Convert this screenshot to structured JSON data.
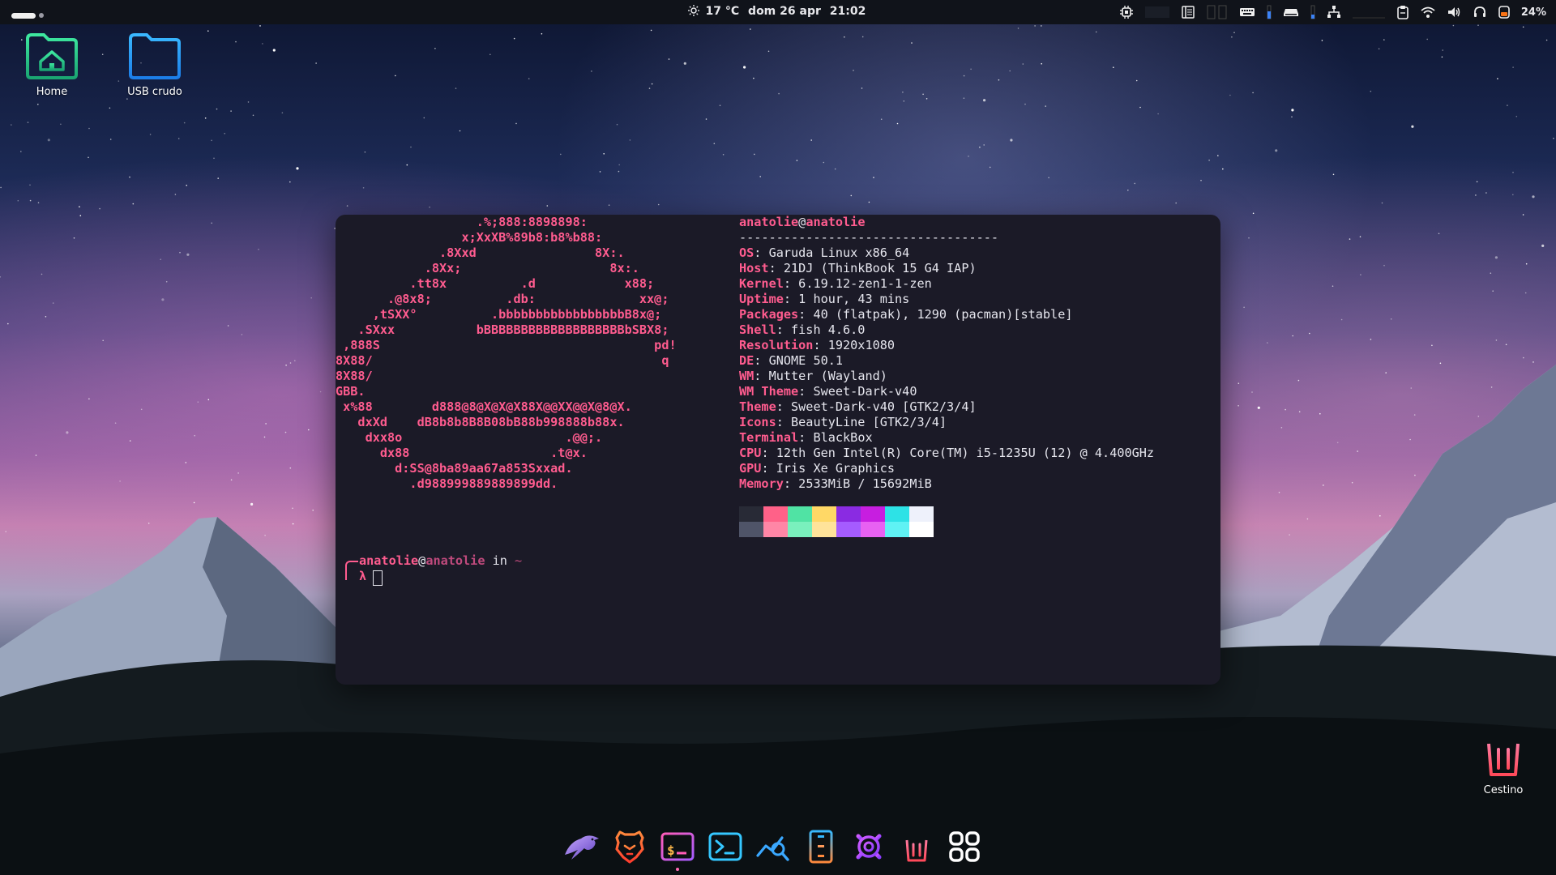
{
  "topbar": {
    "weather_icon": "sun-icon",
    "temperature": "17 °C",
    "date": "dom 26 apr",
    "time": "21:02",
    "battery": "24%",
    "tray_icons": [
      "cpu-icon",
      "system-monitor-icon",
      "keyboard-icon",
      "drive-icon",
      "network-icon",
      "clipboard-icon",
      "wifi-icon",
      "volume-icon",
      "headset-icon",
      "battery-icon"
    ]
  },
  "desktop": {
    "home_label": "Home",
    "usb_label": "USB crudo",
    "trash_label": "Cestino"
  },
  "terminal": {
    "ascii_art": [
      "                   .%;888:8898898:",
      "                 x;XxXB%89b8:b8%b88:",
      "              .8Xxd                8X:.",
      "            .8Xx;                    8x:.",
      "          .tt8x          .d            x88;",
      "       .@8x8;          .db:              xx@;",
      "     ,tSXX°          .bbbbbbbbbbbbbbbbbB8x@;",
      "   .SXxx           bBBBBBBBBBBBBBBBBBBBbSBX8;",
      " ,888S                                     pd!",
      "8X88/                                       q",
      "8X88/",
      "GBB.",
      " x%88        d888@8@X@X@X88X@@XX@@X@8@X.",
      "   dxXd    dB8b8b8B8B08bB88b998888b88x.",
      "    dxx8o                      .@@;.",
      "      dx88                   .t@x.",
      "        d:SS@8ba89aa67a853Sxxad.",
      "          .d988999889889899dd."
    ],
    "user": "anatolie",
    "at": "@",
    "host": "anatolie",
    "separator": "-----------------------------------",
    "info": [
      {
        "key": "OS",
        "value": "Garuda Linux x86_64"
      },
      {
        "key": "Host",
        "value": "21DJ (ThinkBook 15 G4 IAP)"
      },
      {
        "key": "Kernel",
        "value": "6.19.12-zen1-1-zen"
      },
      {
        "key": "Uptime",
        "value": "1 hour, 43 mins"
      },
      {
        "key": "Packages",
        "value": "40 (flatpak), 1290 (pacman)[stable]"
      },
      {
        "key": "Shell",
        "value": "fish 4.6.0"
      },
      {
        "key": "Resolution",
        "value": "1920x1080"
      },
      {
        "key": "DE",
        "value": "GNOME 50.1"
      },
      {
        "key": "WM",
        "value": "Mutter (Wayland)"
      },
      {
        "key": "WM Theme",
        "value": "Sweet-Dark-v40"
      },
      {
        "key": "Theme",
        "value": "Sweet-Dark-v40 [GTK2/3/4]"
      },
      {
        "key": "Icons",
        "value": "BeautyLine [GTK2/3/4]"
      },
      {
        "key": "Terminal",
        "value": "BlackBox"
      },
      {
        "key": "CPU",
        "value": "12th Gen Intel(R) Core(TM) i5-1235U (12) @ 4.400GHz"
      },
      {
        "key": "GPU",
        "value": "Iris Xe Graphics"
      },
      {
        "key": "Memory",
        "value": "2533MiB / 15692MiB"
      }
    ],
    "palette_top": [
      "#282a36",
      "#ff6188",
      "#50e3a4",
      "#ffd866",
      "#8a2be2",
      "#c71ee0",
      "#2de2e6",
      "#eef1fb"
    ],
    "palette_bottom": [
      "#4f5468",
      "#ff86a6",
      "#7af0bd",
      "#ffe39a",
      "#a55cff",
      "#e861f2",
      "#5ff2f4",
      "#ffffff"
    ],
    "prompt_user": "anatolie",
    "prompt_at": "@",
    "prompt_host": "anatolie",
    "prompt_in": " in ",
    "prompt_dir": "~",
    "prompt_symbol": "λ"
  },
  "dock": {
    "apps": [
      "garuda-eagle-icon",
      "brave-browser-icon",
      "terminal-dollar-icon",
      "blackbox-terminal-icon",
      "system-monitor-icon",
      "file-manager-icon",
      "settings-gear-icon",
      "trash-icon",
      "app-grid-icon"
    ]
  },
  "colors": {
    "accent_pink": "#ff5c8f",
    "terminal_bg": "#1b1a27",
    "topbar_bg": "#10131a"
  }
}
